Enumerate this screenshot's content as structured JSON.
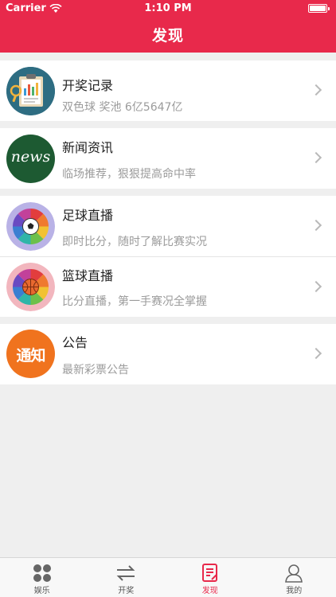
{
  "status_bar": {
    "carrier": "Carrier",
    "time": "1:10 PM"
  },
  "nav": {
    "title": "发现"
  },
  "list": {
    "items": [
      {
        "title": "开奖记录",
        "subtitle": "双色球 奖池 6亿5647亿",
        "icon": "report-clipboard-icon"
      },
      {
        "title": "新闻资讯",
        "subtitle": "临场推荐，狠狠提高命中率",
        "icon": "news-icon"
      },
      {
        "title": "足球直播",
        "subtitle": "即时比分，随时了解比赛实况",
        "icon": "football-icon"
      },
      {
        "title": "篮球直播",
        "subtitle": "比分直播，第一手赛况全掌握",
        "icon": "basketball-icon"
      },
      {
        "title": "公告",
        "subtitle": "最新彩票公告",
        "icon": "notice-icon"
      }
    ],
    "news_icon_text": "news",
    "notice_icon_text": "通知"
  },
  "tabbar": {
    "tabs": [
      {
        "label": "娱乐",
        "icon": "grid-circles-icon"
      },
      {
        "label": "开奖",
        "icon": "swap-arrows-icon"
      },
      {
        "label": "发现",
        "icon": "document-icon"
      },
      {
        "label": "我的",
        "icon": "person-icon"
      }
    ],
    "active_index": 2
  },
  "colors": {
    "brand": "#e8294b",
    "background": "#efefef"
  }
}
